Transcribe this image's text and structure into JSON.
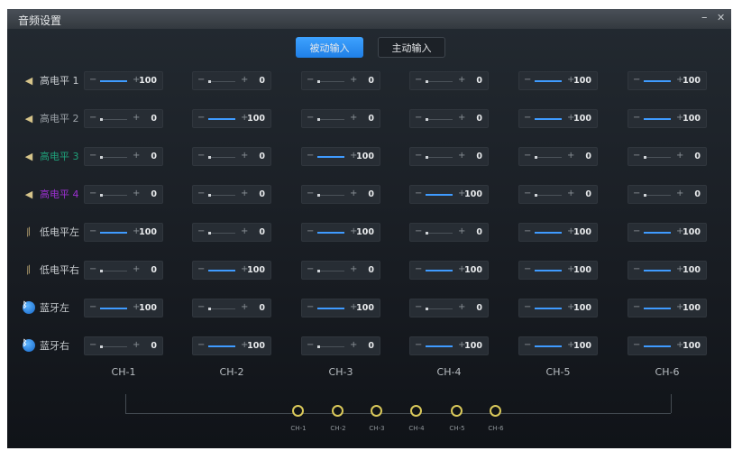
{
  "window": {
    "title": "音频设置",
    "minimize": "–",
    "close": "✕"
  },
  "tabs": [
    {
      "label": "被动输入",
      "active": true
    },
    {
      "label": "主动输入",
      "active": false
    }
  ],
  "accent": "#2a8ff5",
  "rows": [
    {
      "label": "高电平 1",
      "icon": "speaker-icon",
      "color": "#c8ccd0",
      "values": [
        100,
        0,
        0,
        0,
        100,
        100
      ]
    },
    {
      "label": "高电平 2",
      "icon": "speaker-icon",
      "color": "#9aa0a6",
      "values": [
        0,
        100,
        0,
        0,
        100,
        100
      ]
    },
    {
      "label": "高电平 3",
      "icon": "speaker-icon",
      "color": "#1fa07a",
      "values": [
        0,
        0,
        100,
        0,
        0,
        0
      ]
    },
    {
      "label": "高电平 4",
      "icon": "speaker-icon",
      "color": "#9b30d0",
      "values": [
        0,
        0,
        0,
        100,
        0,
        0
      ]
    },
    {
      "label": "低电平左",
      "icon": "rca-cable-icon",
      "color": "#c8ccd0",
      "values": [
        100,
        0,
        100,
        0,
        100,
        100
      ]
    },
    {
      "label": "低电平右",
      "icon": "rca-cable-icon",
      "color": "#c8ccd0",
      "values": [
        0,
        100,
        0,
        100,
        100,
        100
      ]
    },
    {
      "label": "蓝牙左",
      "icon": "bluetooth-icon",
      "color": "#c8ccd0",
      "values": [
        100,
        0,
        100,
        0,
        100,
        100
      ]
    },
    {
      "label": "蓝牙右",
      "icon": "bluetooth-icon",
      "color": "#c8ccd0",
      "values": [
        0,
        100,
        0,
        100,
        100,
        100
      ]
    }
  ],
  "controls": {
    "minus": "−",
    "plus": "+"
  },
  "channels": [
    "CH-1",
    "CH-2",
    "CH-3",
    "CH-4",
    "CH-5",
    "CH-6"
  ],
  "outputs": [
    "CH-1",
    "CH-2",
    "CH-3",
    "CH-4",
    "CH-5",
    "CH-6"
  ]
}
